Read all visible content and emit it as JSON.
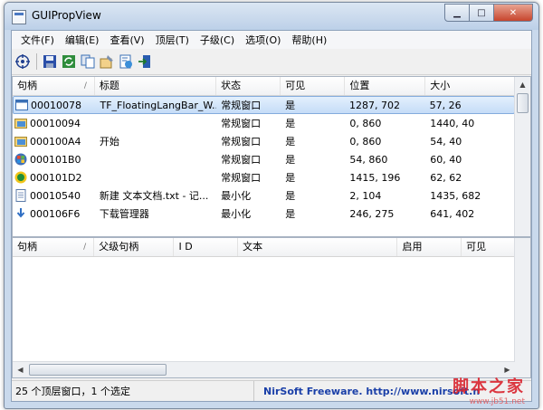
{
  "window": {
    "title": "GUIPropView",
    "min_label": "▁",
    "max_label": "□",
    "close_label": "✕"
  },
  "menu": [
    "文件(F)",
    "编辑(E)",
    "查看(V)",
    "顶层(T)",
    "子级(C)",
    "选项(O)",
    "帮助(H)"
  ],
  "toolbar": [
    {
      "icon": "target-crosshair-icon"
    },
    {
      "icon": "save-icon"
    },
    {
      "icon": "refresh-icon"
    },
    {
      "icon": "copy-icon"
    },
    {
      "icon": "properties-icon"
    },
    {
      "icon": "html-report-icon"
    },
    {
      "icon": "exit-icon"
    }
  ],
  "top_table": {
    "headers": [
      "句柄",
      "标题",
      "状态",
      "可见",
      "位置",
      "大小"
    ],
    "sort_mark": "/",
    "rows": [
      {
        "icon": "window-app-icon",
        "handle": "00010078",
        "title": "TF_FloatingLangBar_W...",
        "state": "常规窗口",
        "visible": "是",
        "pos": "1287, 702",
        "size": "57, 26",
        "selected": true
      },
      {
        "icon": "folder-window-icon",
        "handle": "00010094",
        "title": "",
        "state": "常规窗口",
        "visible": "是",
        "pos": "0, 860",
        "size": "1440, 40",
        "selected": false
      },
      {
        "icon": "folder-window-icon",
        "handle": "000100A4",
        "title": "开始",
        "state": "常规窗口",
        "visible": "是",
        "pos": "0, 860",
        "size": "54, 40",
        "selected": false
      },
      {
        "icon": "windows-logo-icon",
        "handle": "000101B0",
        "title": "",
        "state": "常规窗口",
        "visible": "是",
        "pos": "54, 860",
        "size": "60, 40",
        "selected": false
      },
      {
        "icon": "green-circle-icon",
        "handle": "000101D2",
        "title": "",
        "state": "常规窗口",
        "visible": "是",
        "pos": "1415, 196",
        "size": "62, 62",
        "selected": false
      },
      {
        "icon": "notepad-icon",
        "handle": "00010540",
        "title": "新建 文本文档.txt - 记...",
        "state": "最小化",
        "visible": "是",
        "pos": "2, 104",
        "size": "1435, 682",
        "selected": false
      },
      {
        "icon": "download-arrow-icon",
        "handle": "000106F6",
        "title": "下载管理器",
        "state": "最小化",
        "visible": "是",
        "pos": "246, 275",
        "size": "641, 402",
        "selected": false
      }
    ]
  },
  "bottom_table": {
    "headers": [
      "句柄",
      "父级句柄",
      "I D",
      "文本",
      "启用",
      "可见"
    ],
    "sort_mark": "/"
  },
  "status": {
    "left": "25 个顶层窗口，1 个选定",
    "right": "NirSoft Freeware.  http://www.nirsoft.n"
  },
  "watermark": {
    "title": "脚本之家",
    "url": "www.jb51.net"
  },
  "colors": {
    "selection": "#c5dcf7",
    "link": "#1a3fa8",
    "watermark": "#d9232d"
  }
}
